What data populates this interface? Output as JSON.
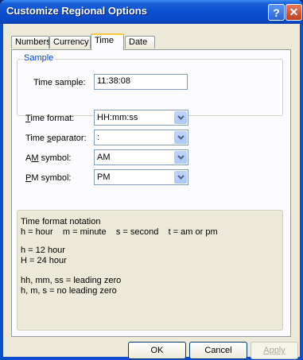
{
  "window": {
    "title": "Customize Regional Options",
    "help_glyph": "?",
    "close_glyph": "✕"
  },
  "tabs": [
    {
      "label": "Numbers"
    },
    {
      "label": "Currency"
    },
    {
      "label": "Time",
      "active": true
    },
    {
      "label": "Date"
    }
  ],
  "sample": {
    "group_label": "Sample",
    "time_sample_label": "Time sample:",
    "time_sample_value": "11:38:08"
  },
  "fields": {
    "time_format": {
      "label_u": "T",
      "label_rest": "ime format:",
      "value": "HH:mm:ss"
    },
    "time_separator": {
      "label_pre": "Time ",
      "label_u": "s",
      "label_rest": "eparator:",
      "value": ":"
    },
    "am_symbol": {
      "label_pre": "A",
      "label_u": "M",
      "label_rest": " symbol:",
      "value": "AM"
    },
    "pm_symbol": {
      "label_u": "P",
      "label_rest": "M symbol:",
      "value": "PM"
    }
  },
  "notation": {
    "title": "Time format notation",
    "line1": "h = hour    m = minute    s = second    t = am or pm",
    "line2": "h = 12 hour",
    "line3": "H = 24 hour",
    "line4": "hh, mm, ss = leading zero",
    "line5": "h, m, s = no leading zero"
  },
  "buttons": {
    "ok": "OK",
    "cancel": "Cancel",
    "apply": "Apply"
  },
  "icons": {
    "dropdown": "chevron-down-icon"
  }
}
